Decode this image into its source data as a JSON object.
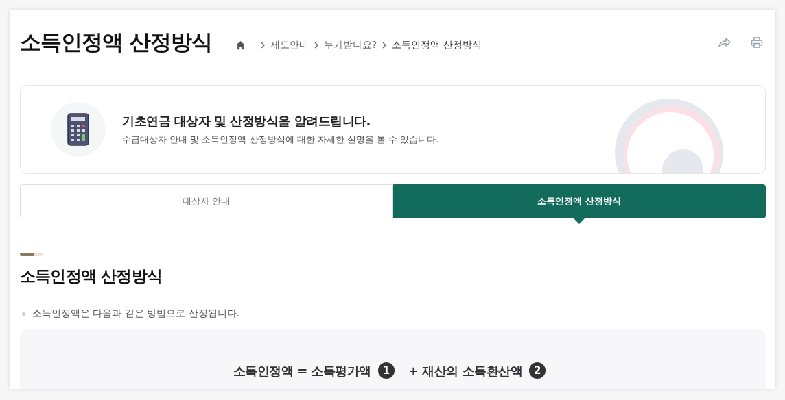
{
  "page_title": "소득인정액 산정방식",
  "breadcrumb": [
    "제도안내",
    "누가받나요?",
    "소득인정액 산정방식"
  ],
  "intro": {
    "heading": "기초연금 대상자 및 산정방식을 알려드립니다.",
    "description": "수급대상자 안내 및 소득인정액 산정방식에 대한 자세한 설명을 볼 수 있습니다."
  },
  "tabs": [
    {
      "label": "대상자 안내",
      "selected": false
    },
    {
      "label": "소득인정액 산정방식",
      "selected": true
    }
  ],
  "section": {
    "title": "소득인정액 산정방식",
    "bullets": [
      "소득인정액은 다음과 같은 방법으로 산정됩니다."
    ],
    "formula": [
      {
        "kind": "text",
        "text": "소득인정액 = 소득평가액"
      },
      {
        "kind": "badge",
        "text": "1"
      },
      {
        "kind": "text",
        "text": "+ 재산의 소득환산액"
      },
      {
        "kind": "badge",
        "text": "2"
      }
    ]
  }
}
